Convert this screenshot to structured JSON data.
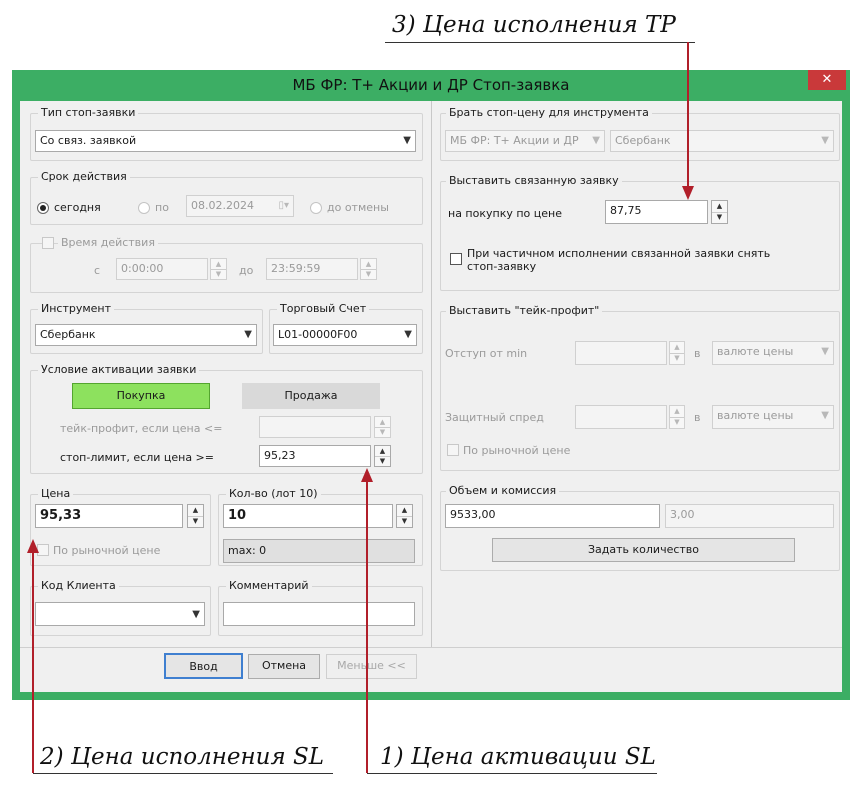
{
  "annotations": {
    "tp": "3) Цена исполнения TP",
    "sl_exec": "2) Цена исполнения SL",
    "sl_act": "1) Цена активации SL"
  },
  "window": {
    "title": "МБ ФР: Т+ Акции и ДР Стоп-заявка",
    "close": "✕",
    "accent_color": "#3cae64",
    "close_color": "#c9393a"
  },
  "order_type": {
    "label": "Тип стоп-заявки",
    "value": "Со связ. заявкой"
  },
  "validity": {
    "label": "Срок действия",
    "today": "сегодня",
    "until": "по",
    "date": "08.02.2024",
    "until_cancel": "до отмены"
  },
  "time": {
    "label": "Время действия",
    "from_label": "с",
    "from": "0:00:00",
    "to_label": "до",
    "to": "23:59:59"
  },
  "instrument": {
    "label": "Инструмент",
    "value": "Сбербанк"
  },
  "account": {
    "label": "Торговый Счет",
    "value": "L01-00000F00"
  },
  "activation": {
    "label": "Условие активации заявки",
    "buy": "Покупка",
    "sell": "Продажа",
    "tp_label": "тейк-профит, если цена <=",
    "tp_value": "",
    "sl_label": "стоп-лимит, если цена >=",
    "sl_value": "95,23"
  },
  "price": {
    "label": "Цена",
    "value": "95,33",
    "market": "По рыночной цене"
  },
  "qty": {
    "label": "Кол-во (лот 10)",
    "value": "10",
    "max": "max: 0"
  },
  "client": {
    "label": "Код Клиента",
    "value": ""
  },
  "comment": {
    "label": "Комментарий",
    "value": ""
  },
  "stop_source": {
    "label": "Брать стоп-цену для инструмента",
    "board": "МБ ФР: Т+ Акции и ДР",
    "instrument": "Сбербанк"
  },
  "linked": {
    "label": "Выставить связанную заявку",
    "buy_label": "на покупку по цене",
    "price": "87,75",
    "partial": "При частичном исполнении связанной заявки снять стоп-заявку"
  },
  "takeprofit": {
    "label": "Выставить \"тейк-профит\"",
    "offset_label": "Отступ от min",
    "offset": "",
    "in1": "в",
    "unit1": "валюте цены",
    "spread_label": "Защитный спред",
    "spread": "",
    "in2": "в",
    "unit2": "валюте цены",
    "market": "По рыночной цене"
  },
  "volume": {
    "label": "Объем и комиссия",
    "amount": "9533,00",
    "commission": "3,00",
    "set_qty": "Задать количество"
  },
  "footer": {
    "enter": "Ввод",
    "cancel": "Отмена",
    "less": "Меньше <<"
  }
}
